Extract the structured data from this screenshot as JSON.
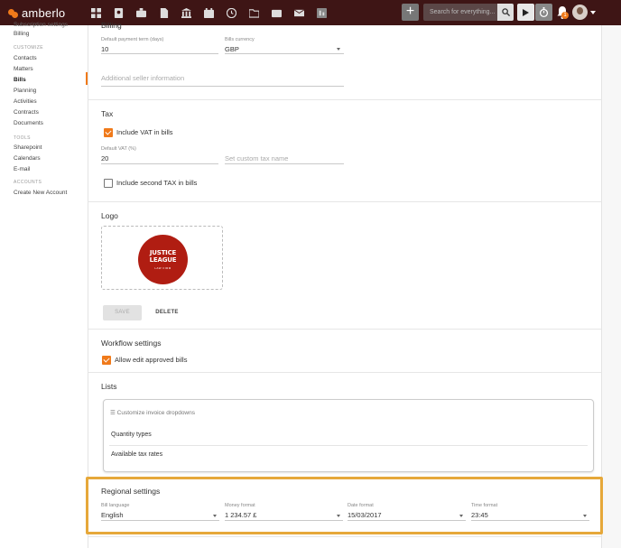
{
  "app": {
    "name": "amberlo"
  },
  "topbar": {
    "nav_icons": [
      "dashboard-icon",
      "contacts-icon",
      "matters-icon",
      "bills-icon",
      "bank-icon",
      "calendar-icon",
      "history-icon",
      "folder-icon",
      "documents-icon",
      "mail-icon",
      "reports-icon"
    ],
    "plus_label": "+",
    "search_placeholder": "Search for everything...",
    "notification_count": "1",
    "accent_color": "#f07a1a",
    "bar_color": "#3e1515"
  },
  "sidebar": {
    "items_top": [
      "Subscription settings",
      "Billing"
    ],
    "customize_header": "CUSTOMIZE",
    "customize_items": [
      "Contacts",
      "Matters",
      "Bills",
      "Planning",
      "Activities",
      "Contracts",
      "Documents"
    ],
    "active_item": "Bills",
    "tools_header": "TOOLS",
    "tools_items": [
      "Sharepoint",
      "Calendars",
      "E-mail"
    ],
    "accounts_header": "ACCOUNTS",
    "accounts_items": [
      "Create New Account"
    ]
  },
  "billing": {
    "title": "Billing",
    "payment_term_label": "Default payment term (days)",
    "payment_term_value": "10",
    "currency_label": "Bills currency",
    "currency_value": "GBP",
    "seller_info_placeholder": "Additional seller information"
  },
  "tax": {
    "title": "Tax",
    "include_vat_label": "Include VAT in bills",
    "include_vat_checked": true,
    "default_vat_label": "Default VAT (%)",
    "default_vat_value": "20",
    "custom_tax_placeholder": "Set custom tax name",
    "second_tax_label": "Include second TAX in bills",
    "second_tax_checked": false
  },
  "logo": {
    "title": "Logo",
    "image_text_line1": "JUSTICE",
    "image_text_line2": "LEAGUE",
    "image_text_line3": "LAW FIRM",
    "save_label": "SAVE",
    "delete_label": "DELETE"
  },
  "workflow": {
    "title": "Workflow settings",
    "allow_edit_label": "Allow edit approved bills",
    "allow_edit_checked": true
  },
  "lists": {
    "title": "Lists",
    "card_header": "Customize invoice dropdowns",
    "rows": [
      "Quantity types",
      "Available tax rates"
    ]
  },
  "regional": {
    "title": "Regional settings",
    "bill_language_label": "Bill language",
    "bill_language_value": "English",
    "money_format_label": "Money format",
    "money_format_value": "1 234.57 £",
    "date_format_label": "Date format",
    "date_format_value": "15/03/2017",
    "time_format_label": "Time format",
    "time_format_value": "23:45",
    "highlight_color": "#e6a83a"
  }
}
